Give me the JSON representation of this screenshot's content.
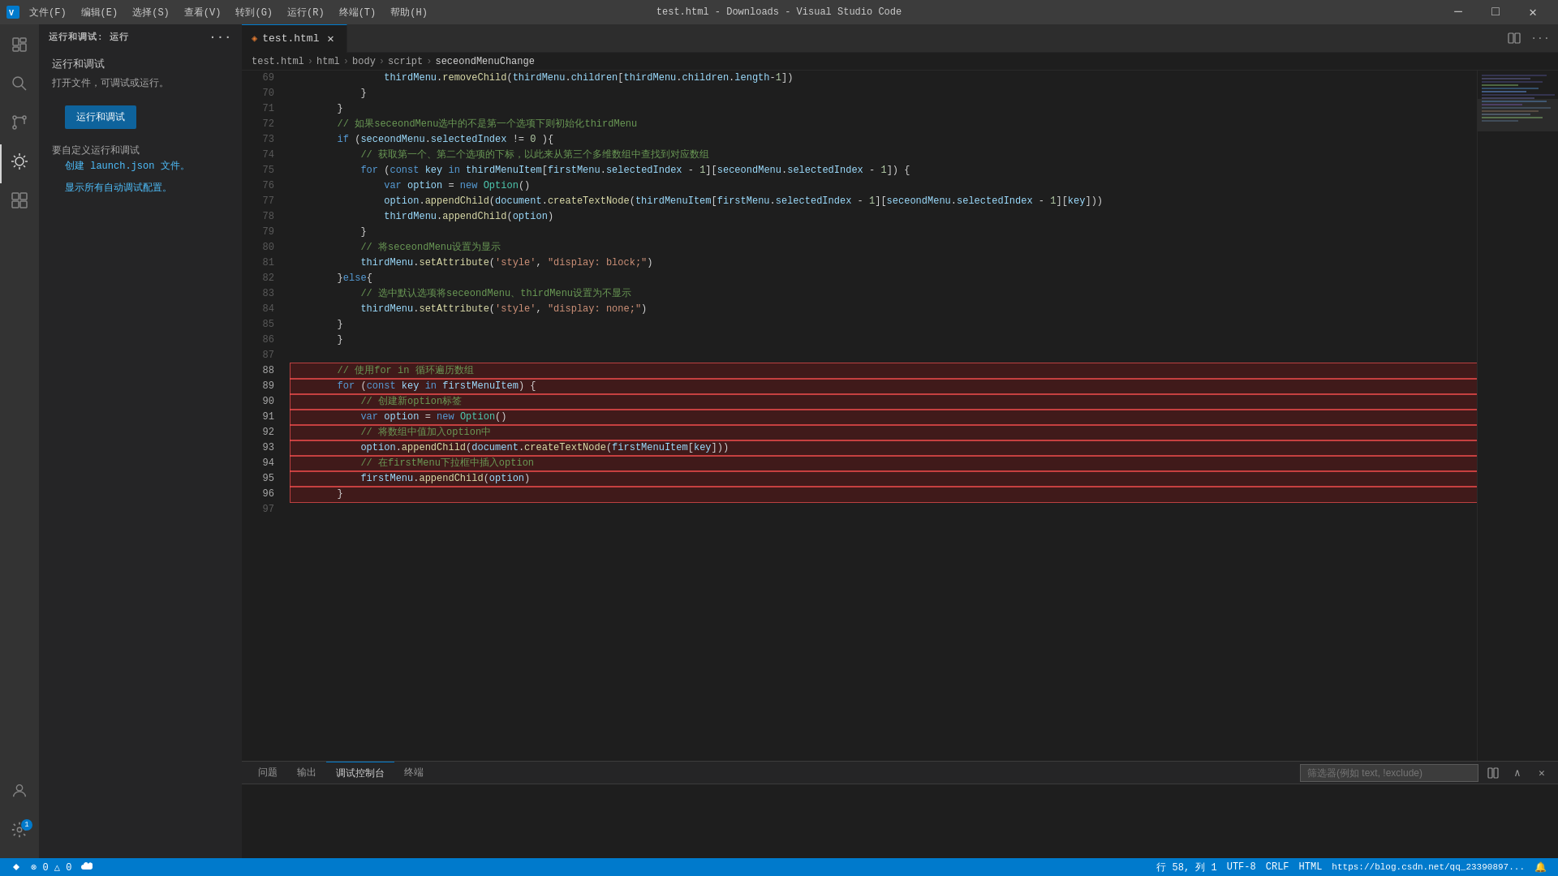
{
  "titlebar": {
    "title": "test.html - Downloads - Visual Studio Code",
    "menus": [
      "文件(F)",
      "编辑(E)",
      "选择(S)",
      "查看(V)",
      "转到(G)",
      "运行(R)",
      "终端(T)",
      "帮助(H)"
    ],
    "controls": [
      "─",
      "□",
      "×"
    ]
  },
  "tabs": [
    {
      "id": "test-html",
      "label": "test.html",
      "active": true,
      "modified": false
    }
  ],
  "breadcrumb": [
    "test.html",
    "html",
    "body",
    "script",
    "seceondMenuChange"
  ],
  "activity": {
    "items": [
      {
        "id": "explorer",
        "icon": "⎘",
        "label": "Explorer"
      },
      {
        "id": "search",
        "icon": "🔍",
        "label": "Search"
      },
      {
        "id": "git",
        "icon": "⎇",
        "label": "Source Control"
      },
      {
        "id": "debug",
        "icon": "▷",
        "label": "Run and Debug",
        "active": true
      },
      {
        "id": "extensions",
        "icon": "⊞",
        "label": "Extensions"
      }
    ],
    "bottom": [
      {
        "id": "account",
        "icon": "👤"
      },
      {
        "id": "settings",
        "icon": "⚙",
        "badge": true
      }
    ]
  },
  "sidebar": {
    "title": "运行和调试: 运行",
    "run_debug_label": "运行和调试",
    "run_label": "运行",
    "info1": "打开文件，可调试或运行。",
    "btn_label": "运行和调试",
    "define_label": "要自定义运行和调试",
    "create_label": "创建 launch.json 文件。",
    "show_label": "显示所有自动调试配置。"
  },
  "code_lines": [
    {
      "num": 69,
      "content": "                thirdMenu.removeChild(thirdMenu.children[thirdMenu.children.length-1])",
      "tokens": [
        {
          "t": "prop",
          "v": "thirdMenu"
        },
        {
          "t": "punc",
          "v": "."
        },
        {
          "t": "fn",
          "v": "removeChild"
        },
        {
          "t": "punc",
          "v": "("
        },
        {
          "t": "prop",
          "v": "thirdMenu"
        },
        {
          "t": "punc",
          "v": "."
        },
        {
          "t": "prop",
          "v": "children"
        },
        {
          "t": "punc",
          "v": "["
        },
        {
          "t": "prop",
          "v": "thirdMenu"
        },
        {
          "t": "punc",
          "v": "."
        },
        {
          "t": "prop",
          "v": "children"
        },
        {
          "t": "punc",
          "v": "."
        },
        {
          "t": "prop",
          "v": "length"
        },
        {
          "t": "punc",
          "v": "-1])"
        }
      ]
    },
    {
      "num": 70,
      "content": "            }",
      "tokens": [
        {
          "t": "punc",
          "v": "            }"
        }
      ]
    },
    {
      "num": 71,
      "content": "        }",
      "tokens": [
        {
          "t": "punc",
          "v": "        }"
        }
      ]
    },
    {
      "num": 72,
      "content": "        // 如果seceondMenu选中的不是第一个选项下则初始化thirdMenu",
      "tokens": [
        {
          "t": "cmt",
          "v": "        // 如果seceondMenu选中的不是第一个选项下则初始化thirdMenu"
        }
      ]
    },
    {
      "num": 73,
      "content": "        if (seceondMenu.selectedIndex != 0 ){",
      "tokens": [
        {
          "t": "kw",
          "v": "        if"
        },
        {
          "t": "punc",
          "v": " ("
        },
        {
          "t": "prop",
          "v": "seceondMenu"
        },
        {
          "t": "punc",
          "v": "."
        },
        {
          "t": "prop",
          "v": "selectedIndex"
        },
        {
          "t": "punc",
          "v": " != "
        },
        {
          "t": "num",
          "v": "0"
        },
        {
          "t": "punc",
          "v": " ){"
        }
      ]
    },
    {
      "num": 74,
      "content": "            // 获取第一个、第二个选项的下标，以此来从第三个多维数组中查找到对应数组",
      "tokens": [
        {
          "t": "cmt",
          "v": "            // 获取第一个、第二个选项的下标，以此来从第三个多维数组中查找到对应数组"
        }
      ]
    },
    {
      "num": 75,
      "content": "            for (const key in thirdMenuItem[firstMenu.selectedIndex - 1][seceondMenu.selectedIndex - 1]) {",
      "tokens": [
        {
          "t": "kw",
          "v": "            for"
        },
        {
          "t": "punc",
          "v": " ("
        },
        {
          "t": "kw",
          "v": "const"
        },
        {
          "t": "punc",
          "v": " "
        },
        {
          "t": "var",
          "v": "key"
        },
        {
          "t": "punc",
          "v": " "
        },
        {
          "t": "kw",
          "v": "in"
        },
        {
          "t": "punc",
          "v": " "
        },
        {
          "t": "prop",
          "v": "thirdMenuItem"
        },
        {
          "t": "punc",
          "v": "["
        },
        {
          "t": "prop",
          "v": "firstMenu"
        },
        {
          "t": "punc",
          "v": "."
        },
        {
          "t": "prop",
          "v": "selectedIndex"
        },
        {
          "t": "punc",
          "v": " - "
        },
        {
          "t": "num",
          "v": "1"
        },
        {
          "t": "punc",
          "v": "]["
        },
        {
          "t": "prop",
          "v": "seceondMenu"
        },
        {
          "t": "punc",
          "v": "."
        },
        {
          "t": "prop",
          "v": "selectedIndex"
        },
        {
          "t": "punc",
          "v": " - "
        },
        {
          "t": "num",
          "v": "1"
        },
        {
          "t": "punc",
          "v": "]) {"
        }
      ]
    },
    {
      "num": 76,
      "content": "                var option = new Option()",
      "tokens": [
        {
          "t": "kw",
          "v": "                var"
        },
        {
          "t": "punc",
          "v": " "
        },
        {
          "t": "var",
          "v": "option"
        },
        {
          "t": "punc",
          "v": " = "
        },
        {
          "t": "kw",
          "v": "new"
        },
        {
          "t": "punc",
          "v": " "
        },
        {
          "t": "type",
          "v": "Option"
        },
        {
          "t": "punc",
          "v": "()"
        }
      ]
    },
    {
      "num": 77,
      "content": "                option.appendChild(document.createTextNode(thirdMenuItem[firstMenu.selectedIndex - 1][seceondMenu.selectedIndex - 1][key]))",
      "tokens": [
        {
          "t": "prop",
          "v": "                option"
        },
        {
          "t": "punc",
          "v": "."
        },
        {
          "t": "fn",
          "v": "appendChild"
        },
        {
          "t": "punc",
          "v": "("
        },
        {
          "t": "var",
          "v": "document"
        },
        {
          "t": "punc",
          "v": "."
        },
        {
          "t": "fn",
          "v": "createTextNode"
        },
        {
          "t": "punc",
          "v": "("
        },
        {
          "t": "prop",
          "v": "thirdMenuItem"
        },
        {
          "t": "punc",
          "v": "["
        },
        {
          "t": "prop",
          "v": "firstMenu"
        },
        {
          "t": "punc",
          "v": "."
        },
        {
          "t": "prop",
          "v": "selectedIndex"
        },
        {
          "t": "punc",
          "v": " - "
        },
        {
          "t": "num",
          "v": "1"
        },
        {
          "t": "punc",
          "v": "]["
        },
        {
          "t": "prop",
          "v": "seceondMenu"
        },
        {
          "t": "punc",
          "v": "."
        },
        {
          "t": "prop",
          "v": "selectedIndex"
        },
        {
          "t": "punc",
          "v": " - "
        },
        {
          "t": "num",
          "v": "1"
        },
        {
          "t": "punc",
          "v": "]["
        },
        {
          "t": "var",
          "v": "key"
        },
        {
          "t": "punc",
          "v": "]))"
        }
      ]
    },
    {
      "num": 78,
      "content": "                thirdMenu.appendChild(option)",
      "tokens": [
        {
          "t": "prop",
          "v": "                thirdMenu"
        },
        {
          "t": "punc",
          "v": "."
        },
        {
          "t": "fn",
          "v": "appendChild"
        },
        {
          "t": "punc",
          "v": "("
        },
        {
          "t": "var",
          "v": "option"
        },
        {
          "t": "punc",
          "v": ")"
        }
      ]
    },
    {
      "num": 79,
      "content": "            }",
      "tokens": [
        {
          "t": "punc",
          "v": "            }"
        }
      ]
    },
    {
      "num": 80,
      "content": "            // 将seceondMenu设置为显示",
      "tokens": [
        {
          "t": "cmt",
          "v": "            // 将seceondMenu设置为显示"
        }
      ]
    },
    {
      "num": 81,
      "content": "            thirdMenu.setAttribute('style', \"display: block;\")",
      "tokens": [
        {
          "t": "prop",
          "v": "            thirdMenu"
        },
        {
          "t": "punc",
          "v": "."
        },
        {
          "t": "fn",
          "v": "setAttribute"
        },
        {
          "t": "punc",
          "v": "('"
        },
        {
          "t": "str",
          "v": "style"
        },
        {
          "t": "punc",
          "v": "', \""
        },
        {
          "t": "str",
          "v": "display: block;"
        },
        {
          "t": "punc",
          "v": "\")"
        }
      ]
    },
    {
      "num": 82,
      "content": "        }else{",
      "tokens": [
        {
          "t": "punc",
          "v": "        }"
        },
        {
          "t": "kw",
          "v": "else"
        },
        {
          "t": "punc",
          "v": "{"
        }
      ]
    },
    {
      "num": 83,
      "content": "            // 选中默认选项将seceondMenu、thirdMenu设置为不显示",
      "tokens": [
        {
          "t": "cmt",
          "v": "            // 选中默认选项将seceondMenu、thirdMenu设置为不显示"
        }
      ]
    },
    {
      "num": 84,
      "content": "            thirdMenu.setAttribute('style', \"display: none;\")",
      "tokens": [
        {
          "t": "prop",
          "v": "            thirdMenu"
        },
        {
          "t": "punc",
          "v": "."
        },
        {
          "t": "fn",
          "v": "setAttribute"
        },
        {
          "t": "punc",
          "v": "('"
        },
        {
          "t": "str",
          "v": "style"
        },
        {
          "t": "punc",
          "v": "', \""
        },
        {
          "t": "str",
          "v": "display: none;"
        },
        {
          "t": "punc",
          "v": "\")"
        }
      ]
    },
    {
      "num": 85,
      "content": "        }",
      "tokens": [
        {
          "t": "punc",
          "v": "        }"
        }
      ]
    },
    {
      "num": 86,
      "content": "        }",
      "tokens": [
        {
          "t": "punc",
          "v": "        }"
        }
      ]
    },
    {
      "num": 87,
      "content": "",
      "tokens": []
    },
    {
      "num": 88,
      "content": "        // 使用for in 循环遍历数组",
      "tokens": [
        {
          "t": "cmt",
          "v": "        // 使用for in 循环遍历数组"
        }
      ],
      "highlight": true
    },
    {
      "num": 89,
      "content": "        for (const key in firstMenuItem) {",
      "tokens": [
        {
          "t": "kw",
          "v": "        for"
        },
        {
          "t": "punc",
          "v": " ("
        },
        {
          "t": "kw",
          "v": "const"
        },
        {
          "t": "punc",
          "v": " "
        },
        {
          "t": "var",
          "v": "key"
        },
        {
          "t": "punc",
          "v": " "
        },
        {
          "t": "kw",
          "v": "in"
        },
        {
          "t": "punc",
          "v": " "
        },
        {
          "t": "prop",
          "v": "firstMenuItem"
        },
        {
          "t": "punc",
          "v": "} {"
        }
      ],
      "highlight": true
    },
    {
      "num": 90,
      "content": "            // 创建新option标签",
      "tokens": [
        {
          "t": "cmt",
          "v": "            // 创建新option标签"
        }
      ],
      "highlight": true
    },
    {
      "num": 91,
      "content": "            var option = new Option()",
      "tokens": [
        {
          "t": "kw",
          "v": "            var"
        },
        {
          "t": "punc",
          "v": " "
        },
        {
          "t": "var",
          "v": "option"
        },
        {
          "t": "punc",
          "v": " = "
        },
        {
          "t": "kw",
          "v": "new"
        },
        {
          "t": "punc",
          "v": " "
        },
        {
          "t": "type",
          "v": "Option"
        },
        {
          "t": "punc",
          "v": "()"
        }
      ],
      "highlight": true
    },
    {
      "num": 92,
      "content": "            // 将数组中值加入option中",
      "tokens": [
        {
          "t": "cmt",
          "v": "            // 将数组中值加入option中"
        }
      ],
      "highlight": true
    },
    {
      "num": 93,
      "content": "            option.appendChild(document.createTextNode(firstMenuItem[key]))",
      "tokens": [
        {
          "t": "prop",
          "v": "            option"
        },
        {
          "t": "punc",
          "v": "."
        },
        {
          "t": "fn",
          "v": "appendChild"
        },
        {
          "t": "punc",
          "v": "("
        },
        {
          "t": "var",
          "v": "document"
        },
        {
          "t": "punc",
          "v": "."
        },
        {
          "t": "fn",
          "v": "createTextNode"
        },
        {
          "t": "punc",
          "v": "("
        },
        {
          "t": "prop",
          "v": "firstMenuItem"
        },
        {
          "t": "punc",
          "v": "["
        },
        {
          "t": "var",
          "v": "key"
        },
        {
          "t": "punc",
          "v": "]))"
        }
      ],
      "highlight": true
    },
    {
      "num": 94,
      "content": "            // 在firstMenu下拉框中插入option",
      "tokens": [
        {
          "t": "cmt",
          "v": "            // 在firstMenu下拉框中插入option"
        }
      ],
      "highlight": true
    },
    {
      "num": 95,
      "content": "            firstMenu.appendChild(option)",
      "tokens": [
        {
          "t": "prop",
          "v": "            firstMenu"
        },
        {
          "t": "punc",
          "v": "."
        },
        {
          "t": "fn",
          "v": "appendChild"
        },
        {
          "t": "punc",
          "v": "("
        },
        {
          "t": "var",
          "v": "option"
        },
        {
          "t": "punc",
          "v": ")"
        }
      ],
      "highlight": true
    },
    {
      "num": 96,
      "content": "        }",
      "tokens": [
        {
          "t": "punc",
          "v": "        }"
        }
      ],
      "highlight": true
    },
    {
      "num": 97,
      "content": "",
      "tokens": []
    }
  ],
  "panel_tabs": [
    {
      "id": "problems",
      "label": "问题"
    },
    {
      "id": "output",
      "label": "输出"
    },
    {
      "id": "debug-console",
      "label": "调试控制台",
      "active": true
    },
    {
      "id": "terminal",
      "label": "终端"
    }
  ],
  "filter_placeholder": "筛选器(例如 text, !exclude)",
  "status_bar": {
    "left": [
      {
        "id": "remote",
        "icon": "⚡",
        "text": ""
      },
      {
        "id": "errors",
        "text": "⊗ 0  △ 0"
      },
      {
        "id": "cloud",
        "text": "☁"
      }
    ],
    "right": [
      {
        "id": "position",
        "text": "行 58, 列 1"
      },
      {
        "id": "encoding",
        "text": "UTF-8"
      },
      {
        "id": "eol",
        "text": "CRLF"
      },
      {
        "id": "language",
        "text": "HTML"
      },
      {
        "id": "url",
        "text": "https://blog.csdn.net/qq_23390897..."
      },
      {
        "id": "bell",
        "text": "🔔"
      }
    ]
  }
}
